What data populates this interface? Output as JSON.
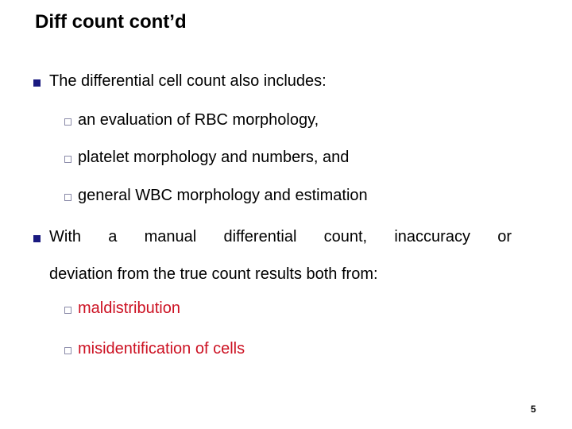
{
  "slide": {
    "title": "Diff count cont’d",
    "bullets": [
      {
        "text": "The differential cell count also includes:",
        "sub": [
          "an evaluation of RBC morphology,",
          "platelet morphology and numbers, and",
          "general WBC morphology and estimation"
        ]
      },
      {
        "text_line1": "With a manual differential count, inaccuracy or",
        "text_line2": "deviation from the true count results both from:",
        "sub": [
          "maldistribution",
          "misidentification of cells"
        ]
      }
    ],
    "page_number": "5",
    "colors": {
      "bullet": "#1a1a80",
      "emphasis": "#cc1122"
    }
  }
}
